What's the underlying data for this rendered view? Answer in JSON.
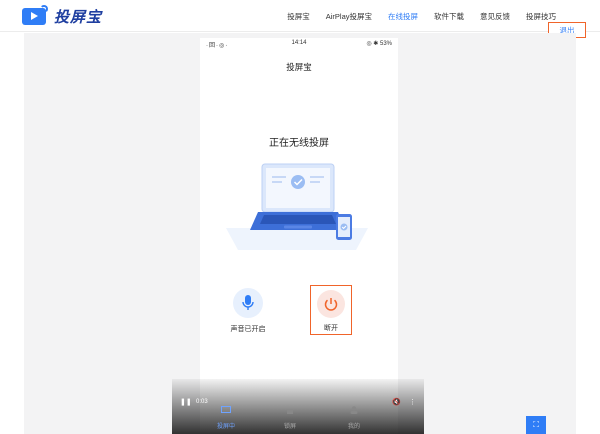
{
  "app": {
    "name": "投屏宝"
  },
  "nav": {
    "items": [
      {
        "label": "投屏宝"
      },
      {
        "label": "AirPlay投屏宝"
      },
      {
        "label": "在线投屏",
        "active": true
      },
      {
        "label": "软件下载"
      },
      {
        "label": "意见反馈"
      },
      {
        "label": "投屏技巧"
      }
    ],
    "exit_label": "退出"
  },
  "phone": {
    "status_time": "14:14",
    "status_left": "·回·◎·",
    "status_right": "◎ ✱ 53%",
    "app_title": "投屏宝",
    "state_title": "正在无线投屏",
    "mic_label": "声音已开启",
    "disconnect_label": "断开"
  },
  "video_bar": {
    "time": "0:03",
    "tabs": [
      {
        "label": "投屏中",
        "active": true
      },
      {
        "label": "锁屏"
      },
      {
        "label": "我的"
      }
    ]
  },
  "colors": {
    "accent": "#2f7df6",
    "highlight": "#f0642a",
    "brand_text": "#1f3fa0"
  }
}
